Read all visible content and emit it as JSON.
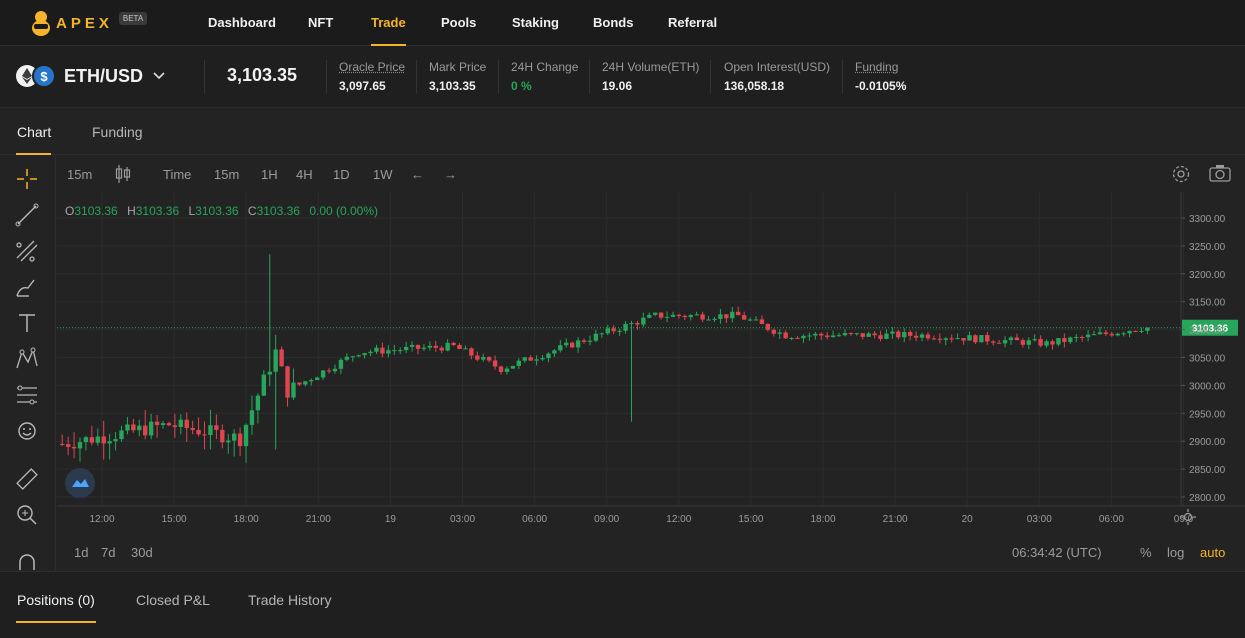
{
  "nav": {
    "logo_text": "APEX",
    "beta_label": "BETA",
    "items": [
      {
        "label": "Dashboard",
        "active": false
      },
      {
        "label": "NFT",
        "active": false
      },
      {
        "label": "Trade",
        "active": true
      },
      {
        "label": "Pools",
        "active": false
      },
      {
        "label": "Staking",
        "active": false
      },
      {
        "label": "Bonds",
        "active": false
      },
      {
        "label": "Referral",
        "active": false
      }
    ]
  },
  "ticker": {
    "pair": "ETH/USD",
    "last_price": "3,103.35",
    "stats": [
      {
        "label": "Oracle Price",
        "value": "3,097.65",
        "dotted": true,
        "color": "white"
      },
      {
        "label": "Mark Price",
        "value": "3,103.35",
        "dotted": false,
        "color": "white"
      },
      {
        "label": "24H Change",
        "value": "0 %",
        "dotted": false,
        "color": "green"
      },
      {
        "label": "24H Volume(ETH)",
        "value": "19.06",
        "dotted": false,
        "color": "white"
      },
      {
        "label": "Open Interest(USD)",
        "value": "136,058.18",
        "dotted": false,
        "color": "white"
      },
      {
        "label": "Funding",
        "value": "-0.0105%",
        "dotted": true,
        "color": "white"
      }
    ]
  },
  "chart_tabs": {
    "chart": "Chart",
    "funding": "Funding"
  },
  "toolbar": {
    "interval": "15m",
    "time_label": "Time",
    "intervals": [
      "15m",
      "1H",
      "4H",
      "1D",
      "1W"
    ],
    "undo": "←",
    "redo": "→"
  },
  "ohlc": {
    "o_label": "O",
    "o": "3103.36",
    "h_label": "H",
    "h": "3103.36",
    "l_label": "L",
    "l": "3103.36",
    "c_label": "C",
    "c": "3103.36",
    "change": "0.00 (0.00%)"
  },
  "chart_data": {
    "type": "candlestick",
    "x_ticks": [
      "12:00",
      "15:00",
      "18:00",
      "21:00",
      "19",
      "03:00",
      "06:00",
      "09:00",
      "12:00",
      "15:00",
      "18:00",
      "21:00",
      "20",
      "03:00",
      "06:00",
      "09:0"
    ],
    "y_ticks": [
      "3300.00",
      "3250.00",
      "3200.00",
      "3150.00",
      "3100.00",
      "3050.00",
      "3000.00",
      "2950.00",
      "2900.00",
      "2850.00",
      "2800.00"
    ],
    "ylim": [
      2790,
      3310
    ],
    "current_price": "3103.36",
    "up_color": "#26a65b",
    "down_color": "#e0454f",
    "key_points": [
      {
        "t": "09:30 18th",
        "close": 2895
      },
      {
        "t": "14:00 18th",
        "close": 2930
      },
      {
        "t": "17:00 18th",
        "close": 2905
      },
      {
        "t": "18:30 18th",
        "close": 3060
      },
      {
        "t": "19:00 18th",
        "close": 2990
      },
      {
        "t": "22:00 18th",
        "close": 3060
      },
      {
        "t": "02:00 19th",
        "close": 3070
      },
      {
        "t": "04:00 19th",
        "close": 3030
      },
      {
        "t": "10:30 19th",
        "close": 3125
      },
      {
        "t": "14:00 19th",
        "close": 3125
      },
      {
        "t": "16:00 19th",
        "close": 3090
      },
      {
        "t": "22:00 19th",
        "close": 3090
      },
      {
        "t": "03:00 20th",
        "close": 3075
      },
      {
        "t": "07:00 20th",
        "close": 3103.36
      }
    ]
  },
  "bottom": {
    "ranges": [
      "1d",
      "7d",
      "30d"
    ],
    "clock": "06:34:42 (UTC)",
    "percent": "%",
    "log": "log",
    "auto": "auto"
  },
  "positions_tabs": [
    "Positions (0)",
    "Closed P&L",
    "Trade History"
  ]
}
